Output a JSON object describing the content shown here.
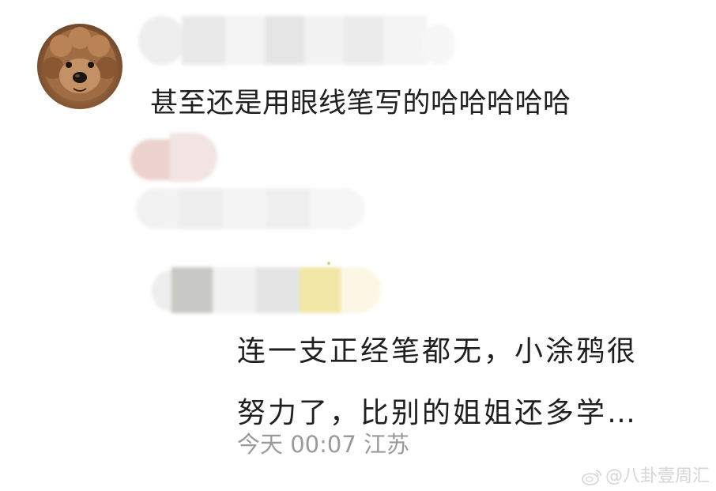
{
  "comment": {
    "text": "甚至还是用眼线笔写的哈哈哈哈哈"
  },
  "reply": {
    "line1": "连一支正经笔都无，小涂鸦很",
    "line2": "努力了，比别的姐姐还多学…",
    "time": "今天 00:07",
    "location": "江苏"
  },
  "watermark": {
    "text": "@八卦壹周汇"
  },
  "icons": {
    "avatar": "dog-avatar",
    "watermark": "weibo-icon"
  }
}
